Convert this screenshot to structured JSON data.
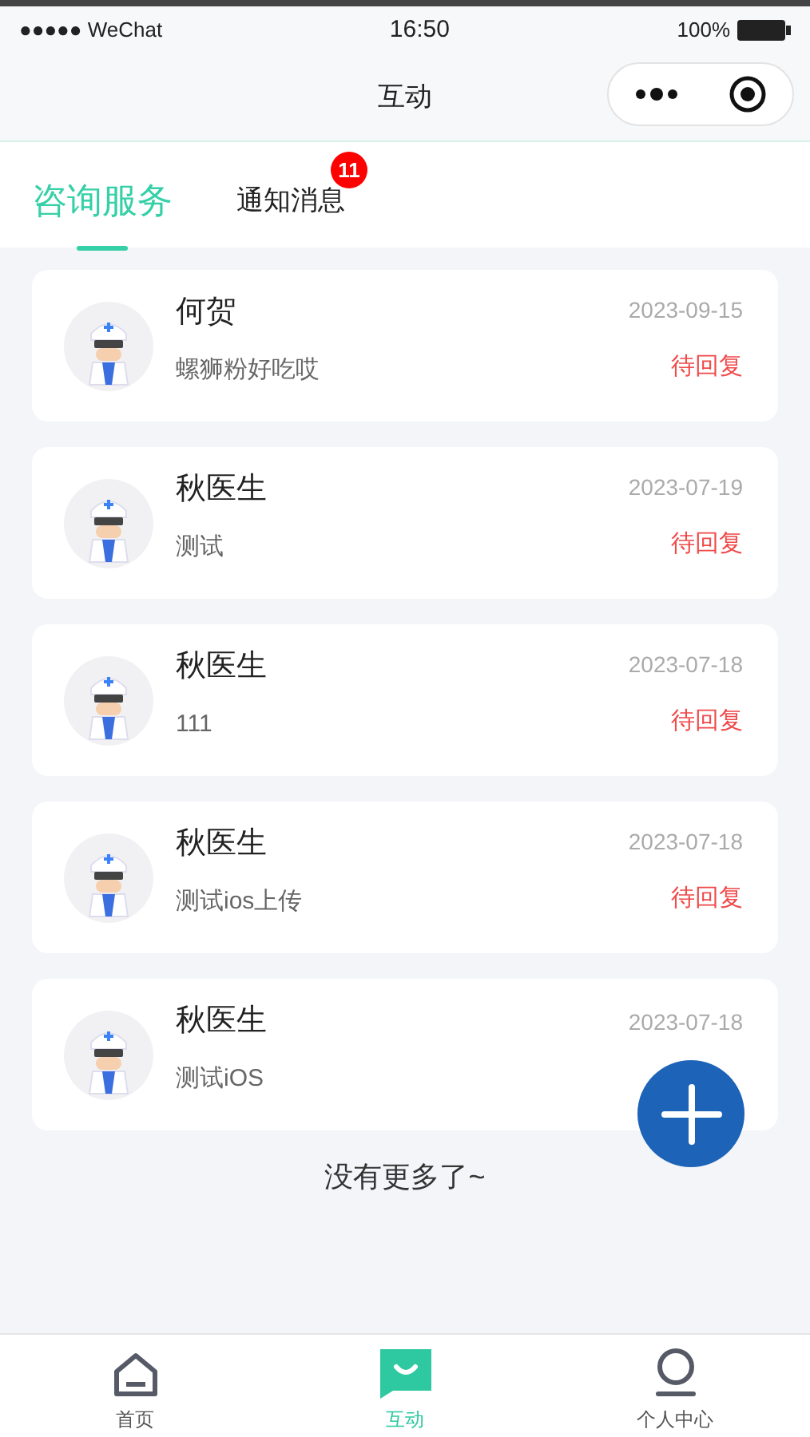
{
  "status_bar": {
    "carrier": "●●●●● WeChat",
    "time": "16:50",
    "battery": "100%"
  },
  "nav": {
    "title": "互动"
  },
  "tabs": [
    {
      "label": "咨询服务",
      "selected": true
    },
    {
      "label": "通知消息",
      "selected": false,
      "badge": "11"
    }
  ],
  "consultations": [
    {
      "name": "何贺",
      "message": "螺狮粉好吃哎",
      "date": "2023-09-15",
      "status": "待回复"
    },
    {
      "name": "秋医生",
      "message": "测试",
      "date": "2023-07-19",
      "status": "待回复"
    },
    {
      "name": "秋医生",
      "message": "111",
      "date": "2023-07-18",
      "status": "待回复"
    },
    {
      "name": "秋医生",
      "message": "测试ios上传",
      "date": "2023-07-18",
      "status": "待回复"
    },
    {
      "name": "秋医生",
      "message": "测试iOS",
      "date": "2023-07-18"
    }
  ],
  "end_note": "没有更多了~",
  "bottom_nav": [
    {
      "kind": "home",
      "label": "首页",
      "selected": false
    },
    {
      "kind": "chat",
      "label": "互动",
      "selected": true
    },
    {
      "kind": "person",
      "label": "个人中心",
      "selected": false
    }
  ]
}
